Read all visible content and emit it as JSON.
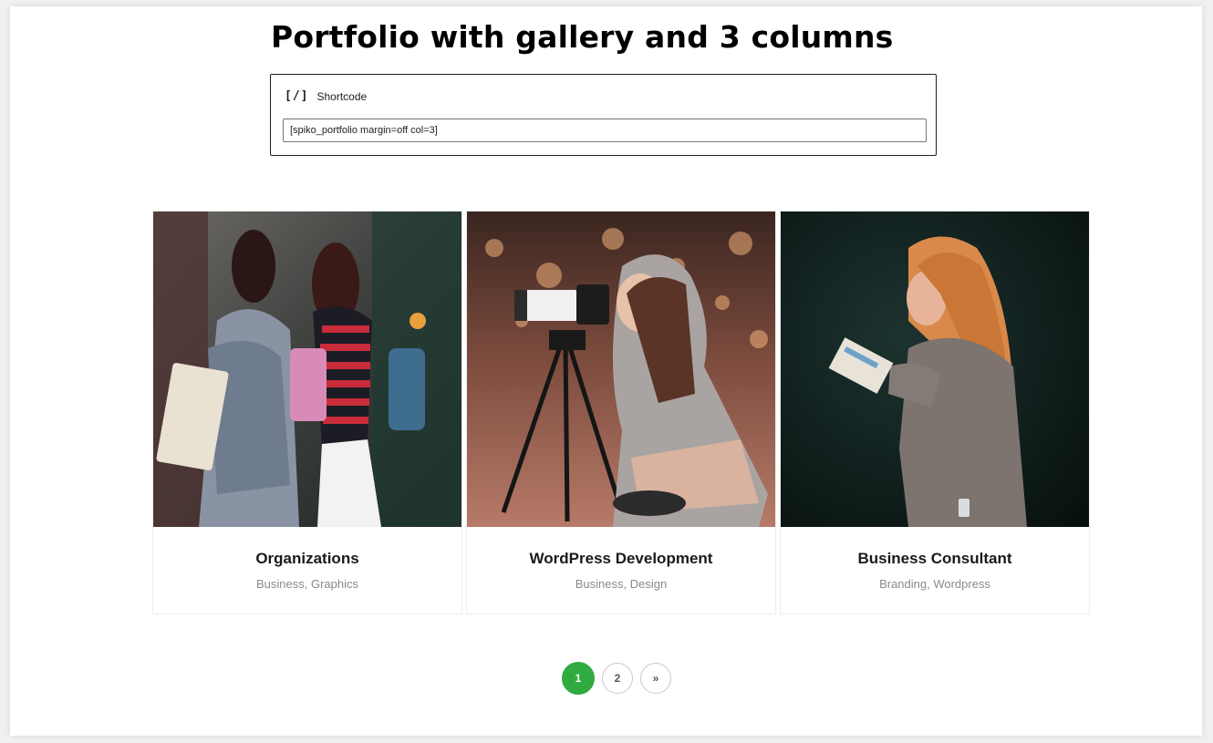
{
  "page": {
    "title": "Portfolio with gallery and 3 columns"
  },
  "shortcode": {
    "icon_glyph": "[/]",
    "label": "Shortcode",
    "value": "[spiko_portfolio margin=off col=3]"
  },
  "portfolio": {
    "items": [
      {
        "title": "Organizations",
        "categories": "Business, Graphics",
        "image": "two-women-walking-photo"
      },
      {
        "title": "WordPress Development",
        "categories": "Business, Design",
        "image": "woman-with-camera-tripod-photo"
      },
      {
        "title": "Business Consultant",
        "categories": "Branding, Wordpress",
        "image": "woman-reading-brochure-photo"
      }
    ]
  },
  "pagination": {
    "pages": [
      "1",
      "2"
    ],
    "next_glyph": "»",
    "current": "1"
  },
  "colors": {
    "accent": "#2fab3f",
    "title_text": "#000000",
    "category_text": "#8a8a8a"
  }
}
